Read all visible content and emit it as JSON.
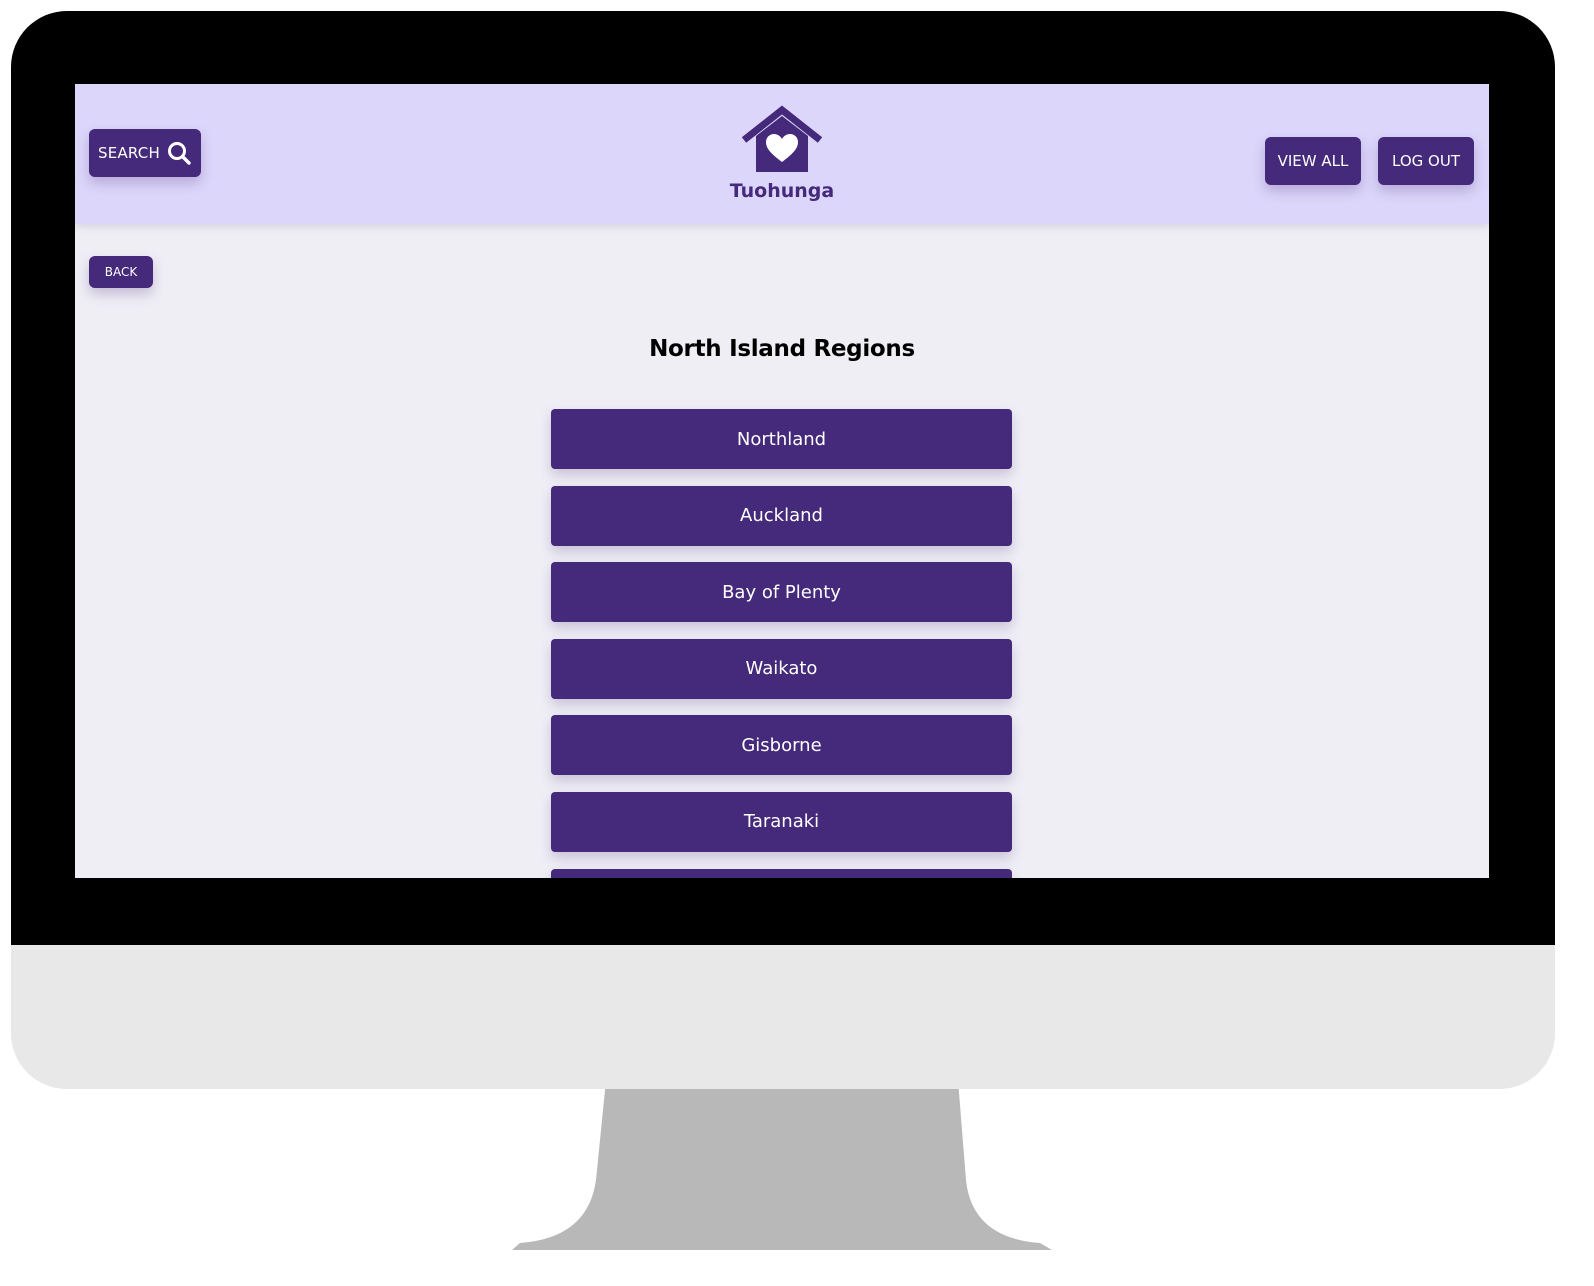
{
  "header": {
    "search_label": "SEARCH",
    "search_icon": "magnifier-icon",
    "logo_icon": "house-heart-icon",
    "brand_name": "Tuohunga",
    "view_all_label": "VIEW ALL",
    "logout_label": "LOG OUT"
  },
  "back_label": "BACK",
  "page_title": "North Island Regions",
  "regions": [
    {
      "label": "Northland"
    },
    {
      "label": "Auckland"
    },
    {
      "label": "Bay of Plenty"
    },
    {
      "label": "Waikato"
    },
    {
      "label": "Gisborne"
    },
    {
      "label": "Taranaki"
    },
    {
      "label": ""
    }
  ],
  "colors": {
    "primary": "#45297a",
    "header_bg": "#dcd6fa",
    "page_bg": "#efeef5",
    "monitor_bezel": "#000000",
    "monitor_chin": "#e8e8e8",
    "monitor_stand": "#b8b8b8"
  }
}
